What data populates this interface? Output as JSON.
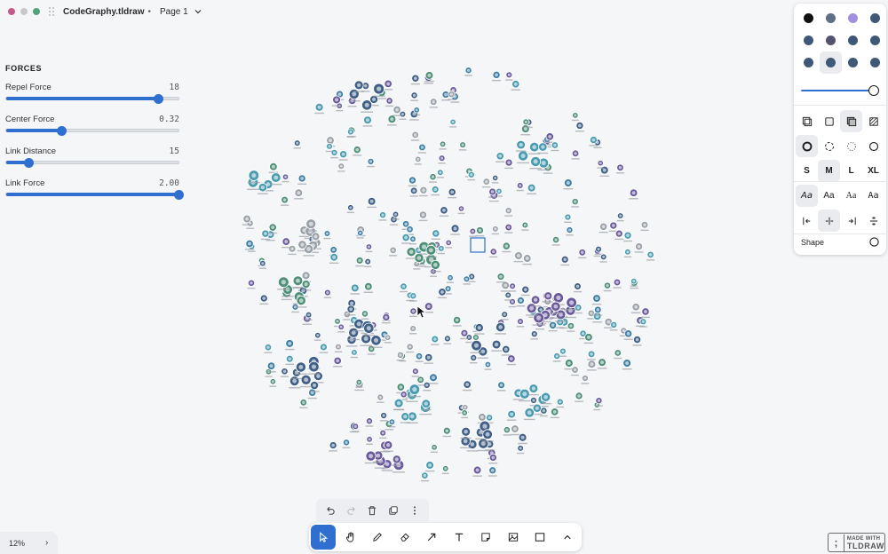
{
  "titlebar": {
    "window_dots": [
      "#c45a8c",
      "#c9c9c9",
      "#52a37c"
    ],
    "document_name": "CodeGraphy.tldraw",
    "document_marker": "•",
    "page_name": "Page 1"
  },
  "forces": {
    "title": "FORCES",
    "sliders": [
      {
        "label": "Repel Force",
        "value": "18",
        "fraction": 0.88
      },
      {
        "label": "Center Force",
        "value": "0.32",
        "fraction": 0.32
      },
      {
        "label": "Link Distance",
        "value": "15",
        "fraction": 0.13
      },
      {
        "label": "Link Force",
        "value": "2.00",
        "fraction": 1.0
      }
    ]
  },
  "style_panel": {
    "colors": [
      "#111111",
      "#5f6f86",
      "#a28fe0",
      "#3f5878",
      "#3f5878",
      "#55546e",
      "#3f5878",
      "#3f5878",
      "#3f5878",
      "#3f5878",
      "#3f5878",
      "#3f5878"
    ],
    "selected_color_index": 9,
    "opacity": 1.0,
    "fill_buttons": [
      "fill-none-icon",
      "fill-semi-icon",
      "fill-solid-icon",
      "fill-pattern-icon"
    ],
    "selected_fill_index": 2,
    "dash_buttons": [
      "dash-draw-icon",
      "dash-dashed-icon",
      "dash-dotted-icon",
      "dash-solid-icon"
    ],
    "selected_dash_index": 0,
    "sizes": [
      "S",
      "M",
      "L",
      "XL"
    ],
    "selected_size_index": 1,
    "fonts": [
      "Aa",
      "Aa",
      "Aa",
      "Aa"
    ],
    "selected_font_index": 0,
    "align_buttons": [
      "align-start-icon",
      "align-middle-icon",
      "align-end-icon",
      "align-vertical-icon"
    ],
    "selected_align_index": 1,
    "shape_label": "Shape"
  },
  "actions_bar": [
    "undo-icon",
    "redo-icon",
    "trash-icon",
    "duplicate-icon",
    "more-icon"
  ],
  "toolbar": {
    "tools": [
      "select-tool-icon",
      "hand-tool-icon",
      "draw-tool-icon",
      "eraser-tool-icon",
      "arrow-tool-icon",
      "text-tool-icon",
      "note-tool-icon",
      "image-tool-icon",
      "rectangle-tool-icon",
      "chevron-up-icon"
    ],
    "selected_index": 0
  },
  "zoom": {
    "label": "12%",
    "expand": "›"
  },
  "made_with": {
    "small": "MADE WITH",
    "big": "TLDRAW",
    "logo": ";"
  },
  "graph": {
    "node_colors": [
      "#3f5f86",
      "#9aa0a8",
      "#6a5a9c",
      "#4e8f78",
      "#3f7fa6",
      "#4a9bb0"
    ]
  }
}
